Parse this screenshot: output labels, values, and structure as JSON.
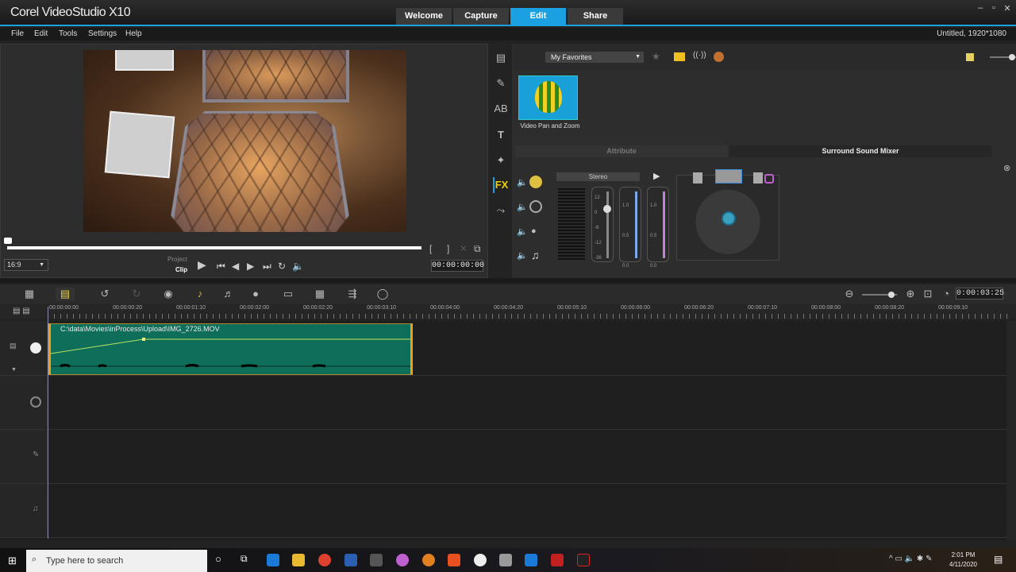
{
  "app": {
    "title": "Corel VideoStudio X10",
    "tabs": [
      "Welcome",
      "Capture",
      "Edit",
      "Share"
    ],
    "active_tab": "Edit",
    "window_controls": [
      "–",
      "▫",
      "✕"
    ]
  },
  "menu": {
    "items": [
      "File",
      "Edit",
      "Tools",
      "Settings",
      "Help"
    ],
    "project_info": "Untitled, 1920*1080"
  },
  "preview": {
    "aspect": "16:9",
    "mode_project": "Project",
    "mode_clip": "Clip",
    "timecode": "00:00:00:00",
    "mark_in": "[",
    "mark_out": "]"
  },
  "library": {
    "folder": "My Favorites",
    "items": [
      {
        "label": "Video Pan and Zoom"
      }
    ],
    "tabs": [
      "Attribute",
      "Surround Sound Mixer"
    ],
    "active_tab": "Surround Sound Mixer"
  },
  "mixer": {
    "channel_mode": "Stereo",
    "fader1_ticks": [
      "12",
      "0",
      "-6",
      "-12",
      "-36"
    ],
    "fader2_ticks": [
      "1.0",
      "0.5",
      "0.0"
    ],
    "fader3_ticks": [
      "1.0",
      "0.5",
      "0.0"
    ]
  },
  "timeline": {
    "duration": "0:00:03:25",
    "ruler": [
      "00:00:00:00",
      "00:00:00:20",
      "00:00:01:10",
      "00:00:02:00",
      "00:00:02:20",
      "00:00:03:10",
      "00:00:04:00",
      "00:00:04:20",
      "00:00:05:10",
      "00:00:06:00",
      "00:00:06:20",
      "00:00:07:10",
      "00:00:08:00",
      "00:00:08:20",
      "00:00:09:10"
    ],
    "clip": {
      "name": "C:\\data\\Movies\\inProcess\\Upload\\IMG_2726.MOV"
    },
    "colors": {
      "clip": "#0f6e5a",
      "clip_border": "#f0a010",
      "accent": "#1ba1e2"
    }
  },
  "taskbar": {
    "search_placeholder": "Type here to search",
    "time": "2:01 PM",
    "date": "4/11/2020"
  }
}
